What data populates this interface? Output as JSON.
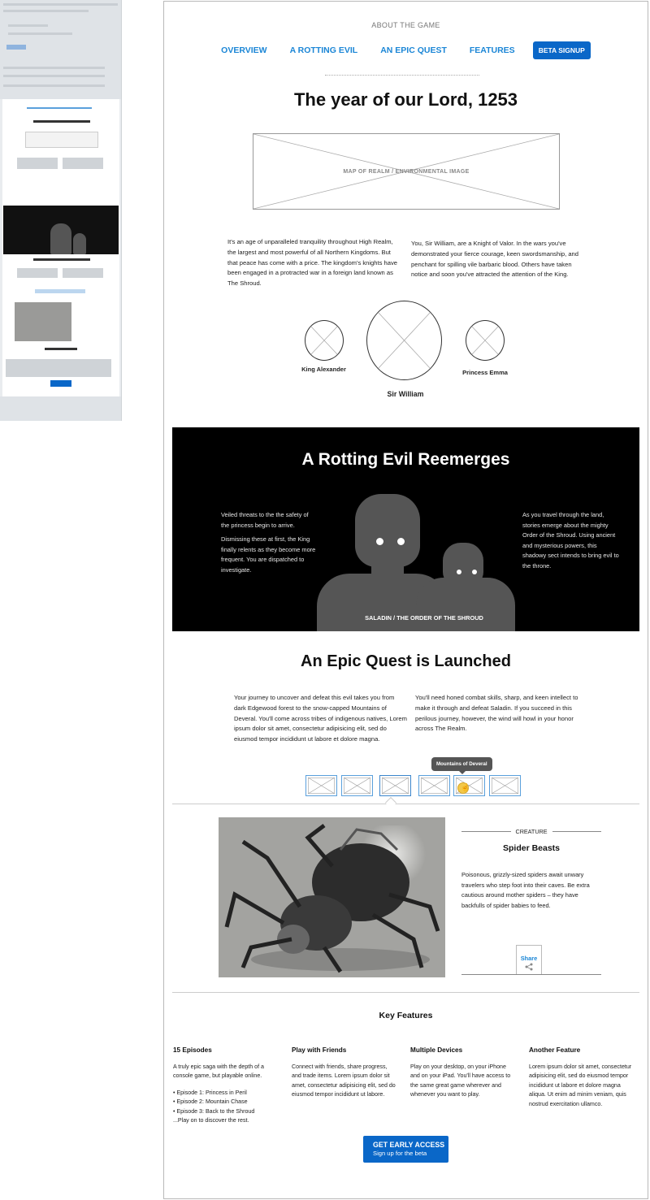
{
  "page": {
    "about_label": "ABOUT THE GAME",
    "nav": [
      {
        "label": "OVERVIEW"
      },
      {
        "label": "A ROTTING EVIL"
      },
      {
        "label": "AN EPIC QUEST"
      },
      {
        "label": "FEATURES"
      }
    ],
    "beta_button": "BETA SIGNUP"
  },
  "intro": {
    "title": "The year of our Lord, 1253",
    "map_caption": "MAP OF REALM / ENVIRONMENTAL IMAGE",
    "left_text": "It's an age of unparalleled tranquility throughout High Realm, the largest and most powerful of all Northern Kingdoms. But that peace has come with a price. The kingdom's knights have been engaged in a protracted war in a foreign land known as The Shroud.",
    "right_text": "You, Sir William, are a Knight of Valor. In the wars you've demonstrated your fierce courage, keen swordsmanship, and penchant for spilling vile barbaric blood. Others have taken notice and soon you've attracted the attention of the King.",
    "characters": [
      {
        "name": "King Alexander"
      },
      {
        "name": "Sir William"
      },
      {
        "name": "Princess Emma"
      }
    ]
  },
  "evil": {
    "title": "A Rotting Evil Reemerges",
    "left_p1": "Veiled threats to the the safety of the princess begin to arrive.",
    "left_p2": "Dismissing these at first, the King finally relents as they become more frequent. You are dispatched to investigate.",
    "right_text": "As you travel through the land, stories emerge about the mighty Order of the Shroud. Using ancient and mysterious powers, this shadowy sect intends to bring evil to the throne.",
    "image_label": "SALADIN / THE ORDER OF THE SHROUD"
  },
  "quest": {
    "title": "An Epic Quest is Launched",
    "left_text": "Your journey to uncover and defeat this evil takes you from dark Edgewood forest to the snow-capped Mountains of Deveral. You'll come across tribes of indigenous natives, Lorem ipsum dolor sit amet, consectetur adipisicing elit, sed do eiusmod tempor incididunt ut labore et dolore magna.",
    "right_text": "You'll need honed combat skills, sharp, and keen intellect to make it through and defeat Saladin. If you succeed in this perilous journey, however, the wind will howl in your honor across The Realm.",
    "tooltip": "Mountains of Deveral",
    "thumb_count": 6,
    "selected_thumb": 3
  },
  "creature": {
    "category": "CREATURE",
    "name": "Spider Beasts",
    "description": "Poisonous, grizzly-sized spiders await unwary travelers who step foot into their caves. Be extra cautious around mother spiders – they have backfulls of spider babies to feed.",
    "share_label": "Share",
    "share_icon": "share-icon"
  },
  "features": {
    "title": "Key Features",
    "columns": [
      {
        "heading": "15 Episodes",
        "body": "A truly epic saga with the depth of a console game, but playable online.",
        "list": [
          "• Episode 1: Princess in Peril",
          "• Episode 2: Mountain Chase",
          "• Episode 3: Back to the Shroud",
          "...Play on to discover the rest."
        ]
      },
      {
        "heading": "Play with Friends",
        "body": "Connect with friends, share progress, and trade items. Lorem ipsum dolor sit amet, consectetur adipisicing elit, sed do eiusmod tempor incididunt ut labore."
      },
      {
        "heading": "Multiple Devices",
        "body": "Play on your desktop, on your iPhone and on your iPad. You'll have access to the same great game wherever and whenever you want to play."
      },
      {
        "heading": "Another Feature",
        "body": "Lorem ipsum dolor sit amet, consectetur adipisicing elit, sed do eiusmod tempor incididunt ut labore et dolore magna aliqua. Ut enim ad minim veniam, quis nostrud exercitation ullamco."
      }
    ],
    "cta_title": "GET EARLY ACCESS",
    "cta_sub": "Sign up for the beta"
  },
  "colors": {
    "accent": "#1b86d6",
    "button": "#0a67c8",
    "dark_section": "#000000"
  }
}
